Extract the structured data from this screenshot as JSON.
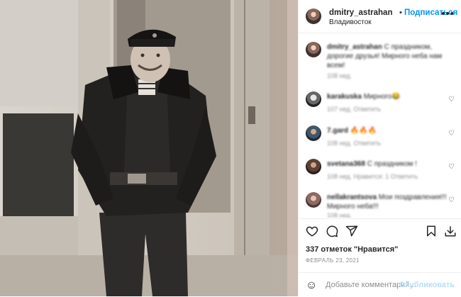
{
  "post": {
    "username": "dmitry_astrahan",
    "follow_label": "Подписаться",
    "separator": "•",
    "location": "Владивосток",
    "more_label": "•••"
  },
  "comments": [
    {
      "user": "dmitry_astrahan",
      "text": " С праздником, дорогие друзья! Мирного неба нам всем!",
      "meta": "108 нед."
    },
    {
      "user": "karakuska",
      "text": " Мирного😂",
      "meta": "107 нед.   Ответить"
    },
    {
      "user": "7.gard",
      "text": " 🔥🔥🔥",
      "meta": "108 нед.   Ответить"
    },
    {
      "user": "svetana368",
      "text": " С праздником !",
      "meta": "108 нед.   Нравится: 1   Ответить"
    },
    {
      "user": "nellakrantsova",
      "text": " Мои поздравления!!! Мирного неба!!!",
      "meta": "108 нед."
    }
  ],
  "likes": "337 отметок \"Нравится\"",
  "date": "ФЕВРАЛЬ 23, 2021",
  "comment_input": {
    "placeholder": "Добавьте комментарий..."
  },
  "post_button": "Опубликовать"
}
